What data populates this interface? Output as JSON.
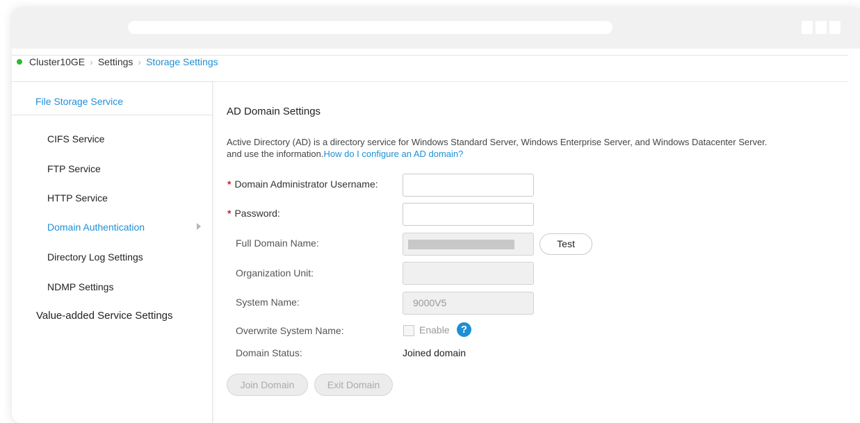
{
  "breadcrumb": {
    "items": [
      "Cluster10GE",
      "Settings"
    ],
    "current": "Storage Settings",
    "status_color": "#2eb82e"
  },
  "sidebar": {
    "header": "File Storage Service",
    "items": [
      {
        "label": "CIFS Service"
      },
      {
        "label": "FTP Service"
      },
      {
        "label": "HTTP Service"
      },
      {
        "label": "Domain Authentication"
      },
      {
        "label": "Directory Log Settings"
      },
      {
        "label": "NDMP Settings"
      }
    ],
    "group": "Value-added Service Settings",
    "active_index": 3
  },
  "content": {
    "title": "AD Domain Settings",
    "description_line1": "Active Directory (AD) is a directory service for Windows Standard Server, Windows Enterprise Server, and Windows Datacenter Server.",
    "description_line2": "and use the information.",
    "help_link": "How do I configure an AD domain?"
  },
  "form": {
    "username_label": "Domain Administrator Username:",
    "username_value": "",
    "password_label": "Password:",
    "password_value": "",
    "full_domain_label": "Full Domain Name:",
    "test_button": "Test",
    "org_unit_label": "Organization Unit:",
    "org_unit_value": "",
    "system_name_label": "System Name:",
    "system_name_value": "9000V5",
    "overwrite_label": "Overwrite System Name:",
    "enable_label": "Enable",
    "help_icon": "question-icon",
    "domain_status_label": "Domain Status:",
    "domain_status_value": "Joined domain",
    "required_marker": "*"
  },
  "actions": {
    "join": "Join Domain",
    "exit": "Exit Domain"
  },
  "colors": {
    "accent": "#1e8fd6",
    "required": "#d0202e"
  }
}
